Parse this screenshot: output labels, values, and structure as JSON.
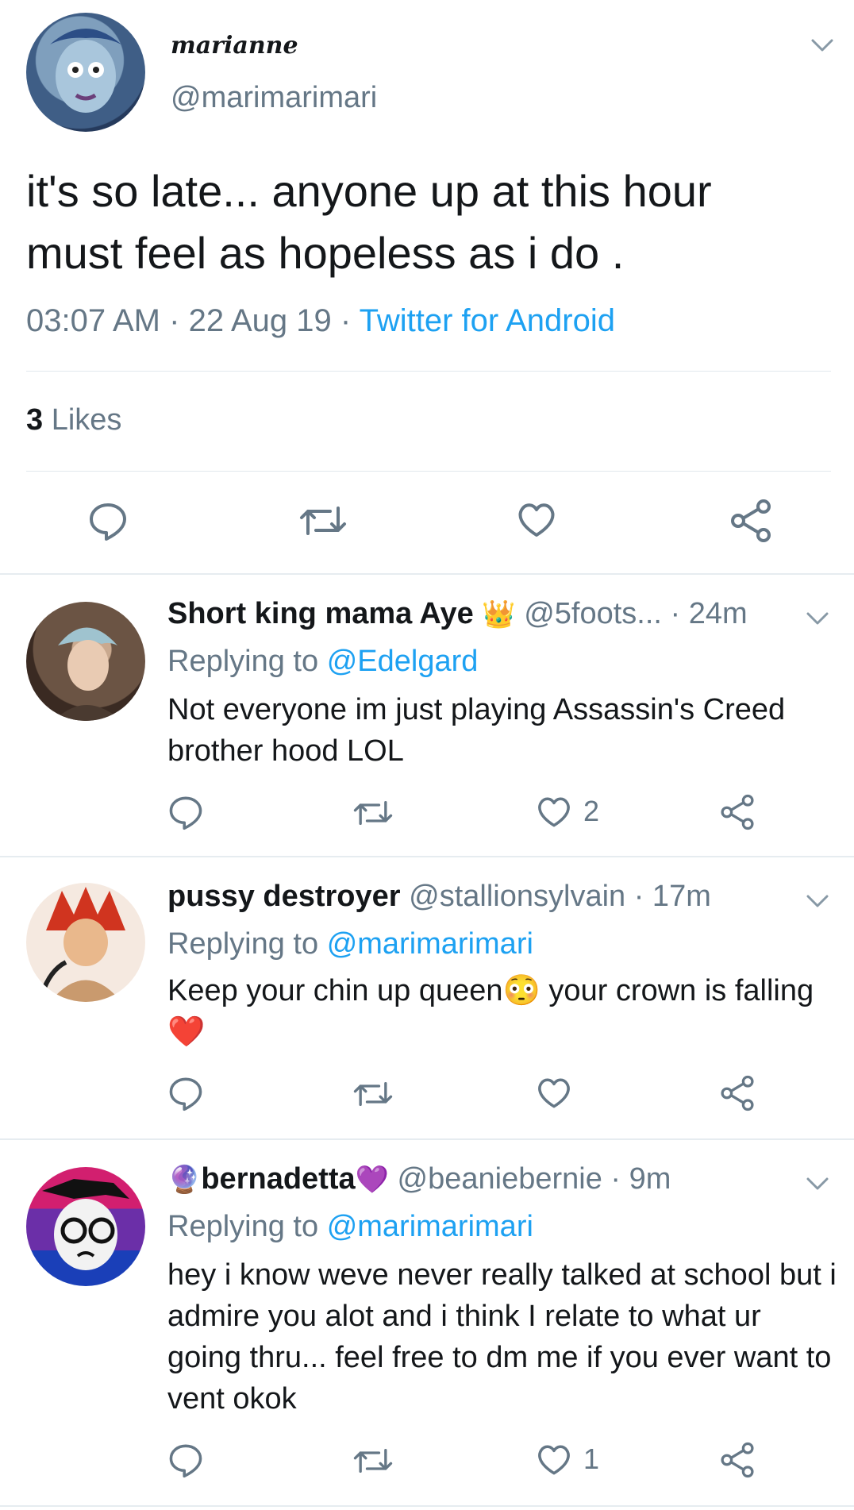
{
  "tweet": {
    "display_name": "marianne",
    "handle": "@marimarimari",
    "text": "it's so late... anyone up at this hour must feel as hopeless as i do .",
    "time": "03:07 AM",
    "date": "22 Aug 19",
    "source": "Twitter for Android",
    "like_count": "3",
    "like_label": "Likes"
  },
  "replies": [
    {
      "name": "Short king mama Aye",
      "name_emoji": "👑",
      "handle": "@5foots...",
      "dot_time": "· 24m",
      "replying_prefix": "Replying to",
      "replying_to": "@Edelgard",
      "text": "Not everyone im just playing Assassin's Creed brother hood LOL",
      "like_count": "2"
    },
    {
      "name": "pussy destroyer",
      "handle": "@stallionsylvain",
      "dot_time": "· 17m",
      "replying_prefix": "Replying to",
      "replying_to": "@marimarimari",
      "text_a": "Keep your chin up queen",
      "emoji_a": "😳",
      "text_b": " your crown is falling ",
      "emoji_b": "❤️",
      "like_count": ""
    },
    {
      "name_prefix_emoji": "🔮",
      "name": "bernadetta",
      "name_emoji": "💜",
      "handle": "@beaniebernie",
      "dot_time": "· 9m",
      "replying_prefix": "Replying to",
      "replying_to": "@marimarimari",
      "text": "hey i know weve never really talked at school but i admire you alot and i think I relate to what ur going thru... feel free to dm me if you ever want to vent okok",
      "like_count": "1"
    }
  ],
  "icons": {
    "reply": "reply-icon",
    "retweet": "retweet-icon",
    "like": "heart-icon",
    "share": "share-icon",
    "menu": "chevron-down-icon"
  },
  "colors": {
    "link": "#1da1f2",
    "muted": "#657786",
    "heart": "#e0245e"
  }
}
